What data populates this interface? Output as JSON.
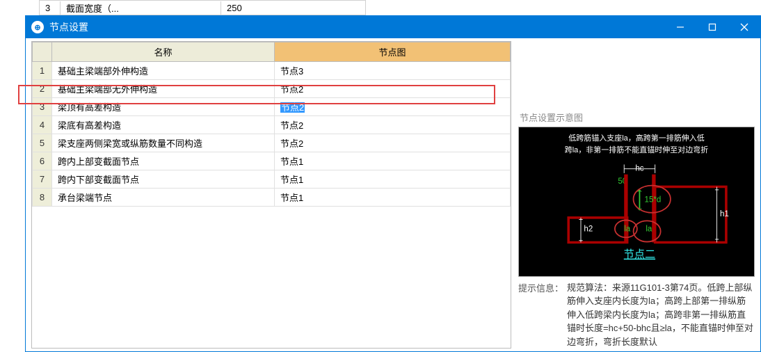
{
  "background": {
    "rownum": "3",
    "label": "截面宽度（...",
    "value": "250"
  },
  "window": {
    "title": "节点设置"
  },
  "columns": {
    "name": "名称",
    "node": "节点图"
  },
  "rows": [
    {
      "num": "1",
      "name": "基础主梁端部外伸构造",
      "node": "节点3"
    },
    {
      "num": "2",
      "name": "基础主梁端部无外伸构造",
      "node": "节点2"
    },
    {
      "num": "3",
      "name": "梁顶有高差构造",
      "node": "节点2",
      "editing": true
    },
    {
      "num": "4",
      "name": "梁底有高差构造",
      "node": "节点2"
    },
    {
      "num": "5",
      "name": "梁支座两侧梁宽或纵筋数量不同构造",
      "node": "节点2"
    },
    {
      "num": "6",
      "name": "跨内上部变截面节点",
      "node": "节点1"
    },
    {
      "num": "7",
      "name": "跨内下部变截面节点",
      "node": "节点1"
    },
    {
      "num": "8",
      "name": "承台梁端节点",
      "node": "节点1"
    }
  ],
  "ellipsis": "···",
  "right": {
    "caption": "节点设置示意图",
    "top_text1": "低跨筋锚入支座la，高跨第一排筋伸入低",
    "top_text2": "跨la，非第一排筋不能直锚时伸至对边弯折",
    "hc": "hc",
    "v50": "50",
    "v15d": "15*d",
    "la1": "la",
    "la2": "la",
    "h1": "h1",
    "h2": "h2",
    "footer": "节点二"
  },
  "tip": {
    "label": "提示信息：",
    "body": "规范算法：来源11G101-3第74页。低跨上部纵筋伸入支座内长度为la；高跨上部第一排纵筋伸入低跨梁内长度为la；高跨非第一排纵筋直锚时长度=hc+50-bhc且≥la，不能直锚时伸至对边弯折，弯折长度默认"
  }
}
